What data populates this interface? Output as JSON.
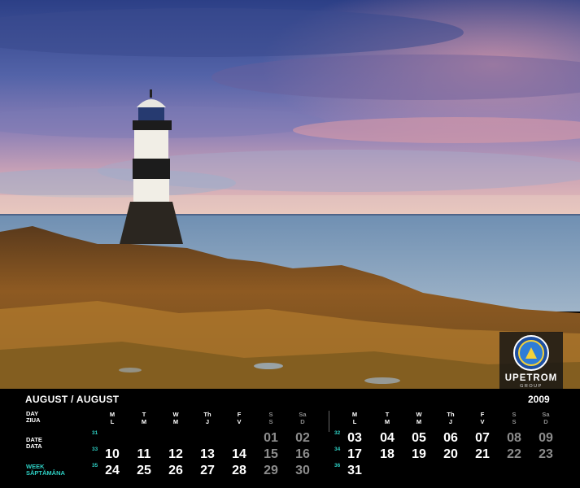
{
  "brand": {
    "name": "UPETROM",
    "sub": "GROUP"
  },
  "calendar": {
    "month": "AUGUST / AUGUST",
    "year": "2009",
    "labels": {
      "day_en": "DAY",
      "day_ro": "ZIUA",
      "date_en": "DATE",
      "date_ro": "DATA",
      "week_en": "WEEK",
      "week_ro": "SĂPTĂMÂNA"
    },
    "left_heads": [
      {
        "en": "M",
        "ro": "L"
      },
      {
        "en": "T",
        "ro": "M"
      },
      {
        "en": "W",
        "ro": "M"
      },
      {
        "en": "Th",
        "ro": "J"
      },
      {
        "en": "F",
        "ro": "V"
      },
      {
        "en": "S",
        "ro": "S"
      },
      {
        "en": "Sa",
        "ro": "D"
      }
    ],
    "right_heads": [
      {
        "en": "M",
        "ro": "L"
      },
      {
        "en": "T",
        "ro": "M"
      },
      {
        "en": "W",
        "ro": "M"
      },
      {
        "en": "Th",
        "ro": "J"
      },
      {
        "en": "F",
        "ro": "V"
      },
      {
        "en": "S",
        "ro": "S"
      },
      {
        "en": "Sa",
        "ro": "D"
      }
    ],
    "left_weeks": [
      "31",
      "33",
      "35"
    ],
    "right_weeks": [
      "32",
      "34",
      "36"
    ],
    "left_rows": [
      [
        "",
        "",
        "",
        "",
        "",
        "01",
        "02"
      ],
      [
        "10",
        "11",
        "12",
        "13",
        "14",
        "15",
        "16"
      ],
      [
        "24",
        "25",
        "26",
        "27",
        "28",
        "29",
        "30"
      ]
    ],
    "right_rows": [
      [
        "03",
        "04",
        "05",
        "06",
        "07",
        "08",
        "09"
      ],
      [
        "17",
        "18",
        "19",
        "20",
        "21",
        "22",
        "23"
      ],
      [
        "31",
        "",
        "",
        "",
        "",
        "",
        ""
      ]
    ]
  }
}
